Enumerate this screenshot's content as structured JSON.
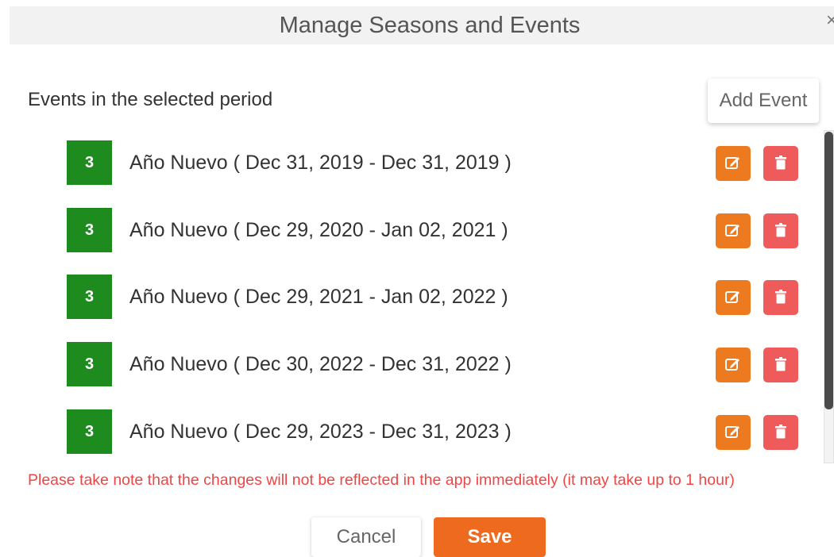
{
  "modal": {
    "title": "Manage Seasons and Events",
    "close_icon": "×"
  },
  "section": {
    "title": "Events in the selected period",
    "add_event_label": "Add Event"
  },
  "events": [
    {
      "badge": "3",
      "label": "Año Nuevo ( Dec 31, 2019 - Dec 31, 2019 )"
    },
    {
      "badge": "3",
      "label": "Año Nuevo ( Dec 29, 2020 - Jan 02, 2021 )"
    },
    {
      "badge": "3",
      "label": "Año Nuevo ( Dec 29, 2021 - Jan 02, 2022 )"
    },
    {
      "badge": "3",
      "label": "Año Nuevo ( Dec 30, 2022 - Dec 31, 2022 )"
    },
    {
      "badge": "3",
      "label": "Año Nuevo ( Dec 29, 2023 - Dec 31, 2023 )"
    }
  ],
  "icons": {
    "edit": "edit-icon",
    "delete": "trash-icon"
  },
  "colors": {
    "badge": "#1e8b1e",
    "edit": "#ee7a1f",
    "delete": "#ef5a5a",
    "save": "#ee6a1f",
    "warning": "#f04545"
  },
  "warning": "Please take note that the changes will not be reflected in the app immediately (it may take up to 1 hour)",
  "footer": {
    "cancel_label": "Cancel",
    "save_label": "Save"
  }
}
